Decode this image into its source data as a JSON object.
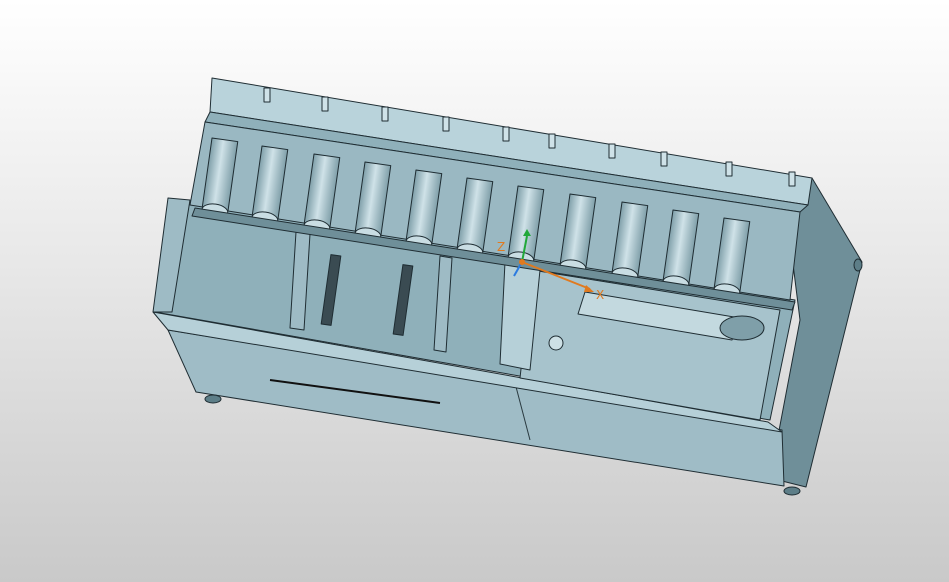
{
  "viewport": {
    "background_top": "#ffffff",
    "background_bottom": "#c9c9c9"
  },
  "model": {
    "body_color": "#a9c6cf",
    "shade_color": "#86a6b0",
    "dark_color": "#5d7e88",
    "edge_color": "#1f2d33",
    "roller_count": 11
  },
  "triad": {
    "x_label": "X",
    "y_label": "",
    "z_label": "Z",
    "x_color": "#e07a1f",
    "y_color": "#2b7be0",
    "z_color": "#22a83a"
  }
}
